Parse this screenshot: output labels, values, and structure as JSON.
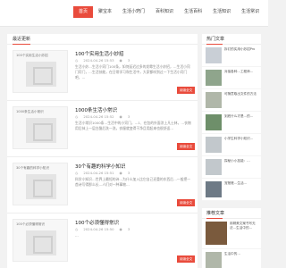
{
  "nav": {
    "items": [
      {
        "label": "首页",
        "active": true
      },
      {
        "label": "聚宝本"
      },
      {
        "label": "生活小窍门"
      },
      {
        "label": "百科知识"
      },
      {
        "label": "生活百科"
      },
      {
        "label": "生活知识"
      },
      {
        "label": "生活常识"
      }
    ]
  },
  "main": {
    "section_title": "最近更新",
    "posts": [
      {
        "thumb_alt": "100个实用生活小妙招",
        "title": "100个实用生活小妙招",
        "date": "2024-04-26 15:53",
        "views": "3",
        "excerpt": "生活小妙…生活小窍门100条，如何延迟过多的发霉生活小妙招，…生活小窍门窍门，…生活技能，在日常学习和生活中，大家都听到过一下生活小窍门吧，…",
        "button": "阅读全文"
      },
      {
        "thumb_alt": "1000条生活小常识",
        "title": "1000条生活小常识",
        "date": "2024-04-26 15:52",
        "views": "3",
        "excerpt": "生活小常识1000条…生活中的小窍门，…1、在包的外面涂上凡士林，…衣物用后抹上一层白醋后洗一洗，衣服就变得干净且用起来也很舒适…",
        "button": "阅读全文"
      },
      {
        "thumb_alt": "30个有趣的科学小知识",
        "title": "30个有趣的科学小知识",
        "date": "2024-04-26 15:51",
        "views": "3",
        "excerpt": "科学小知识…世界上最短的诗…为什么加入比它自己还重的东西后…一般把一首诗写得那么长…人们对一种事物…",
        "button": "阅读全文"
      },
      {
        "thumb_alt": "100个必须懂得常识",
        "title": "100个必须懂得常识",
        "date": "2024-04-26 15:50",
        "views": "3",
        "excerpt": "…",
        "button": "阅读全文"
      }
    ]
  },
  "sidebar": {
    "hot_title": "热门文章",
    "hot_items": [
      {
        "text": "拆钉的实用小妙招Pro"
      },
      {
        "text": "对接各种…工程师…"
      },
      {
        "text": "可随意取出文件的方法"
      },
      {
        "text": "到底什么才是…的…"
      },
      {
        "text": "小学生科学小知识…"
      },
      {
        "text": "探秘小小技能：…"
      },
      {
        "text": "宠爸爸…生活…"
      }
    ],
    "recommend_title": "推荐文章",
    "recommend_items": [
      {
        "text": "用精美文案书写无法…生活中的…"
      },
      {
        "text": "生活中的…"
      }
    ]
  }
}
